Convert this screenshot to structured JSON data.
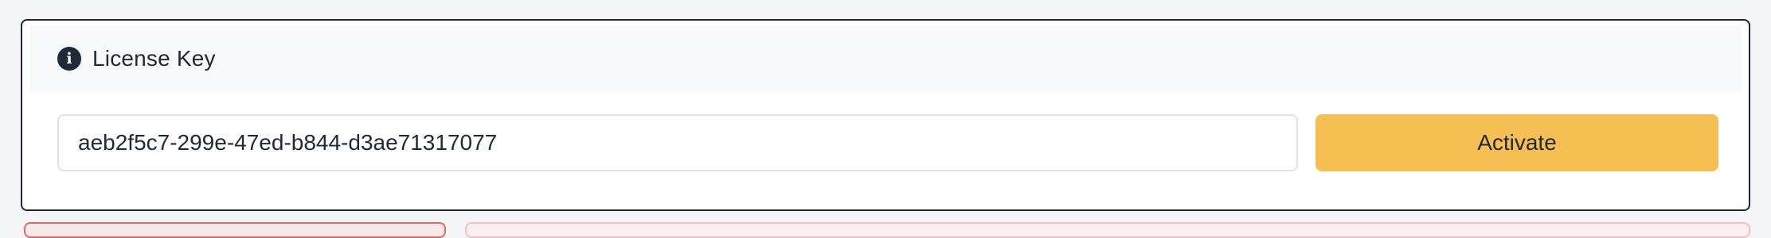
{
  "license_card": {
    "title": "License Key",
    "header_icon": "info-icon",
    "input_value": "aeb2f5c7-299e-47ed-b844-d3ae71317077",
    "activate_label": "Activate",
    "accent_color": "#f5bf53",
    "border_color": "#1d2533"
  },
  "alerts": {
    "left_border_color": "#dc6b6b",
    "right_border_color": "#efc2c2"
  }
}
